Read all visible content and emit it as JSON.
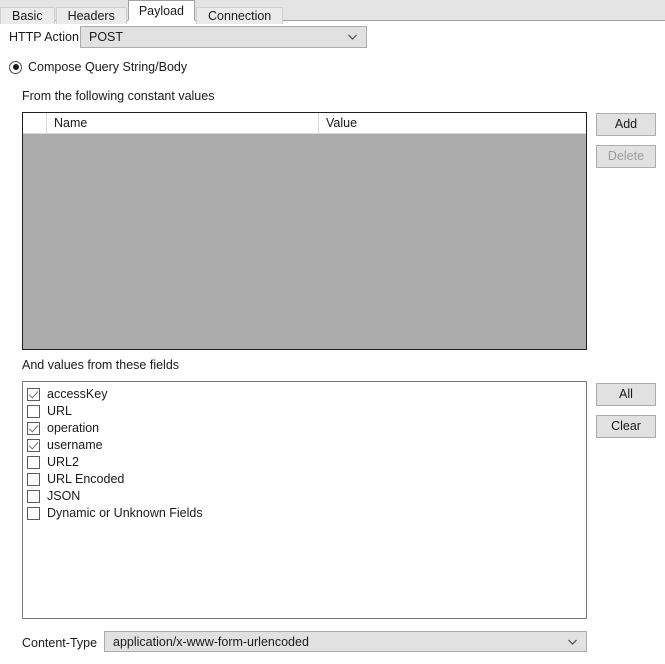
{
  "tabs": [
    {
      "label": "Basic",
      "active": false
    },
    {
      "label": "Headers",
      "active": false
    },
    {
      "label": "Payload",
      "active": true
    },
    {
      "label": "Connection",
      "active": false
    }
  ],
  "http_action": {
    "label": "HTTP Action",
    "value": "POST",
    "chevron_icon": "chevron-down-icon"
  },
  "compose_option": {
    "label": "Compose Query String/Body",
    "selected": true
  },
  "constants_section": {
    "caption": "From the following constant values",
    "columns": [
      "",
      "Name",
      "Value"
    ],
    "rows": [],
    "add_label": "Add",
    "delete_label": "Delete",
    "delete_enabled": false
  },
  "fields_section": {
    "caption": "And values from these fields",
    "all_label": "All",
    "clear_label": "Clear",
    "items": [
      {
        "label": "accessKey",
        "checked": true
      },
      {
        "label": "URL",
        "checked": false
      },
      {
        "label": "operation",
        "checked": true
      },
      {
        "label": "username",
        "checked": true
      },
      {
        "label": "URL2",
        "checked": false
      },
      {
        "label": "URL Encoded",
        "checked": false
      },
      {
        "label": "JSON",
        "checked": false
      },
      {
        "label": "Dynamic or Unknown Fields",
        "checked": false
      }
    ]
  },
  "content_type": {
    "label": "Content-Type",
    "value": "application/x-www-form-urlencoded",
    "chevron_icon": "chevron-down-icon"
  },
  "colors": {
    "tabstrip_bg": "#e4e4e4",
    "page_bg": "#ffffff",
    "grid_body": "#acacac",
    "control_face": "#e1e1e1",
    "disabled_text": "#9d9d9d",
    "text": "#1a1a1a"
  }
}
